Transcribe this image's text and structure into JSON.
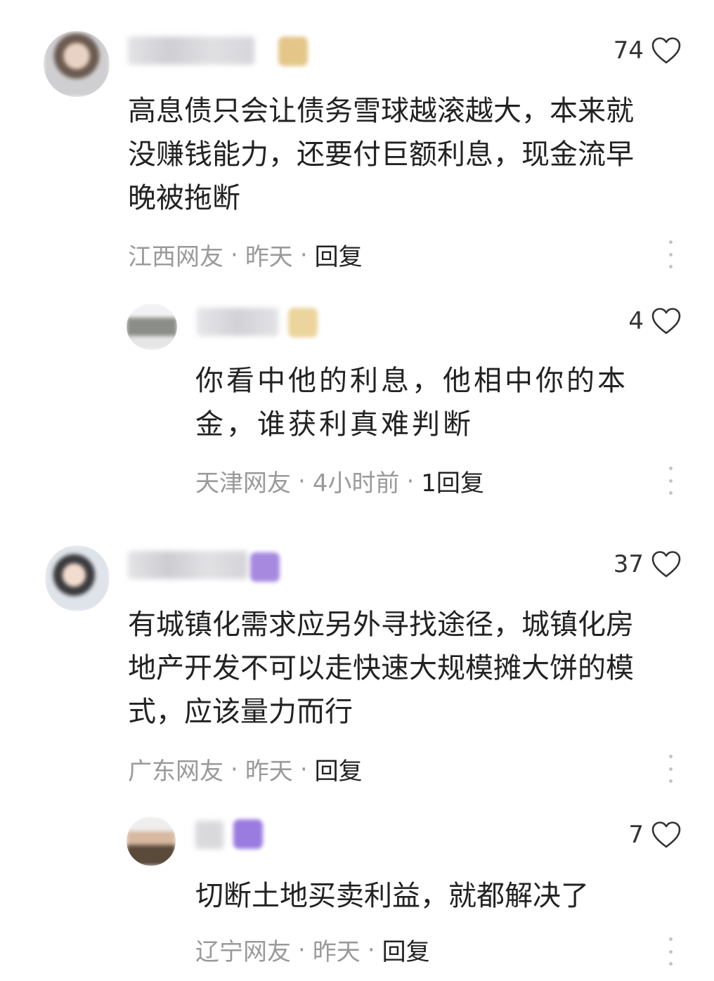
{
  "comments": [
    {
      "likes": "74",
      "text": "高息债只会让债务雪球越滚越大，本来就没赚钱能力，还要付巨额利息，现金流早晚被拖断",
      "location": "江西网友",
      "time": "昨天",
      "reply_label": "回复"
    },
    {
      "likes": "4",
      "text": "你看中他的利息，他相中你的本金，谁获利真难判断",
      "location": "天津网友",
      "time": "4小时前",
      "reply_label": "1回复"
    },
    {
      "likes": "37",
      "text": "有城镇化需求应另外寻找途径，城镇化房地产开发不可以走快速大规模摊大饼的模式，应该量力而行",
      "location": "广东网友",
      "time": "昨天",
      "reply_label": "回复"
    },
    {
      "likes": "7",
      "text": "切断土地买卖利益，就都解决了",
      "location": "辽宁网友",
      "time": "昨天",
      "reply_label": "回复"
    }
  ],
  "separator": "·",
  "icons": {
    "like": "heart-outline-icon",
    "more": "vertical-ellipsis-icon"
  },
  "colors": {
    "text": "#222222",
    "meta": "#9a9a9a",
    "badge_gold": "#e8c98a",
    "badge_purple": "#9a7be0"
  }
}
